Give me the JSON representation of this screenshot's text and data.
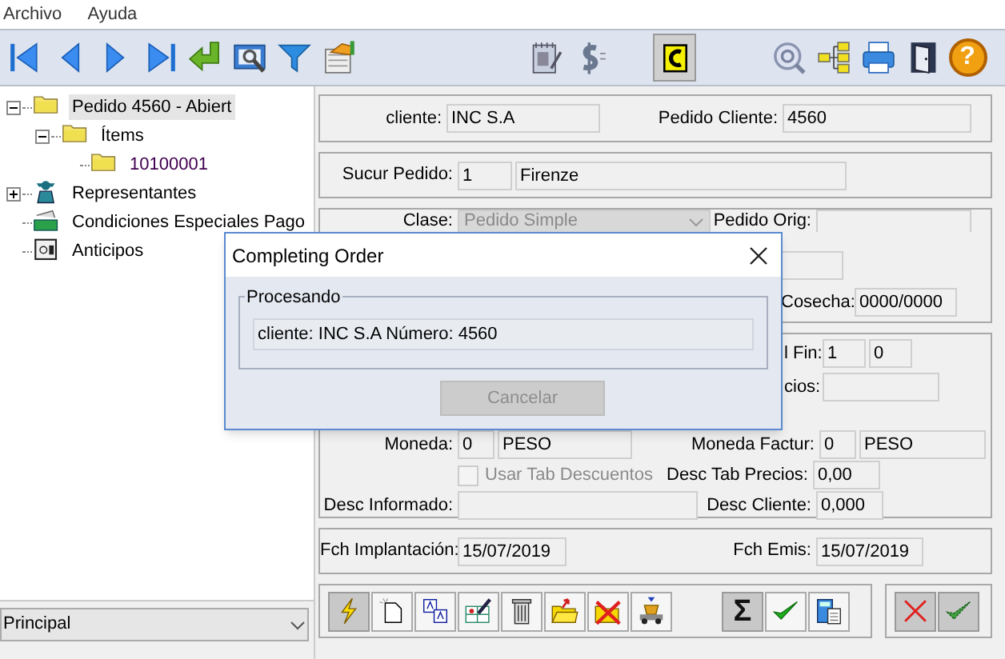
{
  "menu": [
    "Archivo",
    "Ayuda"
  ],
  "toolbar": [
    {
      "kind": "first",
      "pressed": false
    },
    {
      "kind": "prev",
      "pressed": false
    },
    {
      "kind": "next",
      "pressed": false
    },
    {
      "kind": "last",
      "pressed": false
    },
    {
      "kind": "enter",
      "pressed": false
    },
    {
      "kind": "preview",
      "pressed": false
    },
    {
      "kind": "filter",
      "pressed": false
    },
    {
      "kind": "report",
      "pressed": false
    },
    {
      "kind": "gap"
    },
    {
      "kind": "notepad",
      "pressed": false
    },
    {
      "kind": "dollar",
      "pressed": false
    },
    {
      "kind": "gap"
    },
    {
      "kind": "copy",
      "pressed": true
    },
    {
      "kind": "gap"
    },
    {
      "kind": "zoom",
      "pressed": false
    },
    {
      "kind": "tree",
      "pressed": false
    },
    {
      "kind": "printer",
      "pressed": false
    },
    {
      "kind": "door",
      "pressed": false
    },
    {
      "kind": "help",
      "glyph": "?",
      "pressed": false
    }
  ],
  "tree": [
    {
      "label": "Pedido 4560 - Abiert",
      "kind": "folder",
      "expanded": true,
      "selected": true,
      "children": [
        {
          "label": "Ítems",
          "kind": "folder",
          "expanded": true,
          "selected": false,
          "children": [
            {
              "label": "10100001",
              "kind": "record",
              "selected": false
            }
          ]
        }
      ]
    },
    {
      "label": "Representantes",
      "kind": "person",
      "expanded": false,
      "selected": false
    },
    {
      "label": "Condiciones Especiales Pago",
      "kind": "money",
      "selected": false
    },
    {
      "label": "Anticipos",
      "kind": "safe",
      "selected": false
    }
  ],
  "view_selector": {
    "value": "Principal"
  },
  "header": {
    "cliente_label": "cliente:",
    "cliente": "INC  S.A",
    "pedido_cliente_label": "Pedido Cliente:",
    "pedido_cliente": "4560"
  },
  "sucursal": {
    "label": "Sucur Pedido:",
    "code": "1",
    "name": "Firenze"
  },
  "clase": {
    "label": "Clase:",
    "value": "Pedido Simple",
    "disabled": true,
    "pedido_orig_label": "Pedido Orig:",
    "cosecha_label": "Cosecha:",
    "cosecha": "0000/0000"
  },
  "terms": {
    "fin_label": "l Fin:",
    "fin_1": "1",
    "fin_2": "0",
    "precios_label": "cios:",
    "moneda_label": "Moneda:",
    "moneda_code": "0",
    "moneda": "PESO",
    "moneda_factur_label": "Moneda Factur:",
    "moneda_factur_code": "0",
    "moneda_factur": "PESO",
    "usar_tab": {
      "label": "Usar Tab Descuentos",
      "checked": false,
      "disabled": true
    },
    "desc_tab_label": "Desc Tab Precios:",
    "desc_tab": "0,00",
    "desc_informado_label": "Desc Informado:",
    "desc_cliente_label": "Desc Cliente:",
    "desc_cliente": "0,000"
  },
  "dates": {
    "implantacion_label": "Fch Implantación:",
    "implantacion": "15/07/2019",
    "emis_label": "Fch Emis:",
    "emis": "15/07/2019"
  },
  "actions": [
    {
      "kind": "lightning"
    },
    {
      "kind": "new"
    },
    {
      "kind": "translate"
    },
    {
      "kind": "grid-edit"
    },
    {
      "kind": "trash"
    },
    {
      "kind": "open"
    },
    {
      "kind": "folder-x"
    },
    {
      "kind": "loader"
    },
    {
      "kind": "gap"
    },
    {
      "kind": "sum",
      "glyph": "Σ"
    },
    {
      "kind": "check"
    },
    {
      "kind": "calc"
    }
  ],
  "confirm_actions": [
    {
      "kind": "cancel"
    },
    {
      "kind": "accept"
    }
  ],
  "dialog": {
    "title": "Completing Order",
    "group_label": "Procesando",
    "message": "cliente: INC  S.A Número: 4560",
    "button": {
      "label": "Cancelar",
      "disabled": true
    }
  }
}
